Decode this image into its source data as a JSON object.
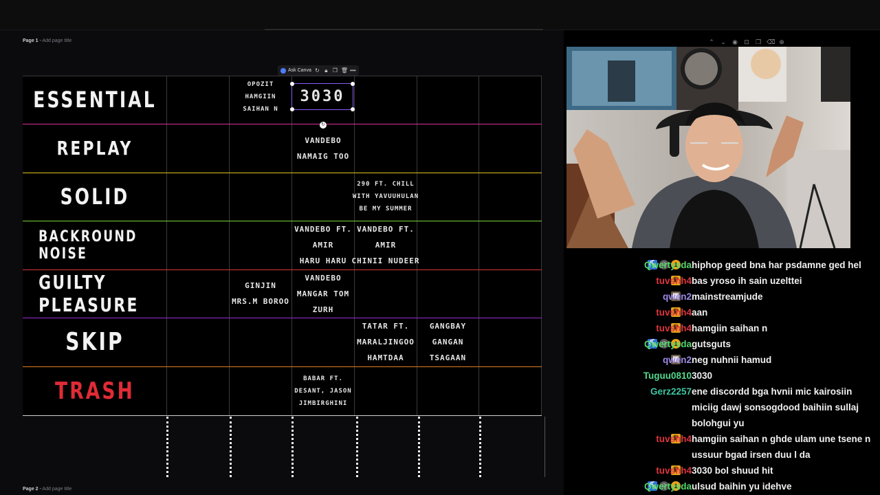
{
  "page1": {
    "title": "Page 1",
    "sep": " - ",
    "placeholder": "Add page title"
  },
  "page2": {
    "title": "Page 2",
    "sep": " - ",
    "placeholder": "Add page title"
  },
  "toolbar": {
    "ask_canva": "Ask Canva",
    "more": "•••"
  },
  "tier_rows": [
    {
      "label": "ESSENTIAL",
      "line_color": "#e0309a",
      "label_color": "#f2f2f2"
    },
    {
      "label": "REPLAY",
      "line_color": "#e4c51d",
      "label_color": "#f2f2f2"
    },
    {
      "label": "SOLID",
      "line_color": "#7ad43d",
      "label_color": "#f2f2f2"
    },
    {
      "label": "BACKROUND NOISE",
      "line_color": "#d93636",
      "label_color": "#f2f2f2"
    },
    {
      "label": "GUILTY PLEASURE",
      "line_color": "#9b2ed6",
      "label_color": "#f2f2f2"
    },
    {
      "label": "SKIP",
      "line_color": "#e07e22",
      "label_color": "#f2f2f2"
    },
    {
      "label": "TRASH",
      "line_color": "#d0d0d0",
      "label_color": "#e02b36"
    }
  ],
  "cells": {
    "opozit": "OPOZIT\nHAMGIIN\nSAIHAN N",
    "selected": "3030",
    "vandebo_namaig": "VANDEBO\nNAMAIG TOO",
    "chill": "290 FT. CHILL\nWITH YAVUUHULAN\nBE MY SUMMER",
    "vandebo_amir1": "VANDEBO FT.\nAMIR\nHARU HARU",
    "vandebo_amir2": "VANDEBO FT.\nAMIR\nCHINII NUDEER",
    "ginjin": "GINJIN\nMRS.M BOROO",
    "vandebo_mangar": "VANDEBO\nMANGAR TOM\nZURH",
    "tatar": "TATAR FT.\nMARALJINGOO\nHAMTDAA",
    "gangbay": "GANGBAY\nGANGAN\nTSAGAAN",
    "babar": "BABAR FT.\nDESANT, JASON\nJIMBIRGHINI"
  },
  "chat": [
    {
      "badges": [
        "pick",
        "ava",
        "gold"
      ],
      "user": "Qwertysda",
      "color": "#55d86a",
      "text": "hiphop geed bna har psdamne ged hel"
    },
    {
      "badges": [
        "crown"
      ],
      "user": "tuvshh4",
      "color": "#e0353f",
      "text": "bas yroso ih sain uzelttei"
    },
    {
      "badges": [
        "photo"
      ],
      "user": "qwen2",
      "color": "#9d8ae6",
      "text": "mainstreamjude"
    },
    {
      "badges": [
        "crown"
      ],
      "user": "tuvshh4",
      "color": "#e0353f",
      "text": "aan"
    },
    {
      "badges": [
        "crown"
      ],
      "user": "tuvshh4",
      "color": "#e0353f",
      "text": "hamgiin saihan n"
    },
    {
      "badges": [
        "pick",
        "ava",
        "gold"
      ],
      "user": "Qwertysda",
      "color": "#55d86a",
      "text": "gutsguts"
    },
    {
      "badges": [
        "photo"
      ],
      "user": "qwen2",
      "color": "#9d8ae6",
      "text": "neg nuhnii hamud"
    },
    {
      "badges": [],
      "user": "Tuguu0810",
      "color": "#54d98c",
      "text": "3030"
    },
    {
      "badges": [],
      "user": "Gerz2257",
      "color": "#3fc4a0",
      "text": "ene discordd bga hvnii mic kairosiin miciig dawj sonsogdood baihiin sullaj bolohgui yu"
    },
    {
      "badges": [
        "crown"
      ],
      "user": "tuvshh4",
      "color": "#e0353f",
      "text": "hamgiin saihan n ghde ulam une tsene n ussuur bgad irsen duu l da"
    },
    {
      "badges": [
        "crown"
      ],
      "user": "tuvshh4",
      "color": "#e0353f",
      "text": "3030 bol shuud hit"
    },
    {
      "badges": [
        "pick",
        "ava",
        "gold"
      ],
      "user": "Qwertysda",
      "color": "#55d86a",
      "text": "ulsud baihin yu idehve"
    }
  ]
}
